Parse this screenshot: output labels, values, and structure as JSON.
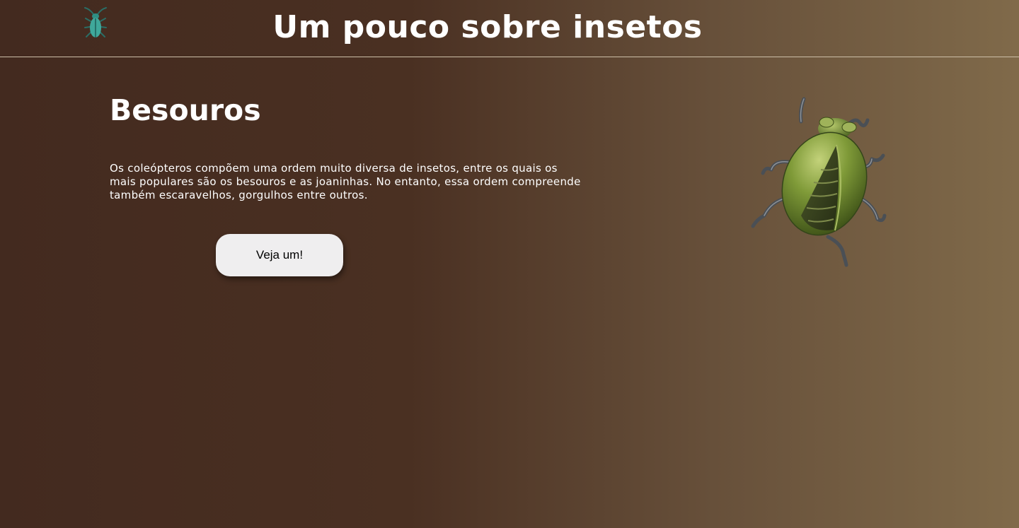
{
  "header": {
    "title": "Um pouco sobre insetos",
    "logo_icon": "beetle-icon",
    "logo_color": "#3fa89b"
  },
  "main": {
    "section_title": "Besouros",
    "description": "Os coleópteros compõem uma ordem muito diversa de insetos, entre os quais os mais populares são os besouros e as joaninhas. No entanto, essa ordem compreende também escaravelhos, gorgulhos entre outros.",
    "button_label": "Veja um!",
    "image_icon": "green-beetle-illustration"
  },
  "colors": {
    "background_left": "#432a1f",
    "background_right": "#806a4a",
    "button_bg": "#efeeef",
    "text": "#ffffff"
  }
}
